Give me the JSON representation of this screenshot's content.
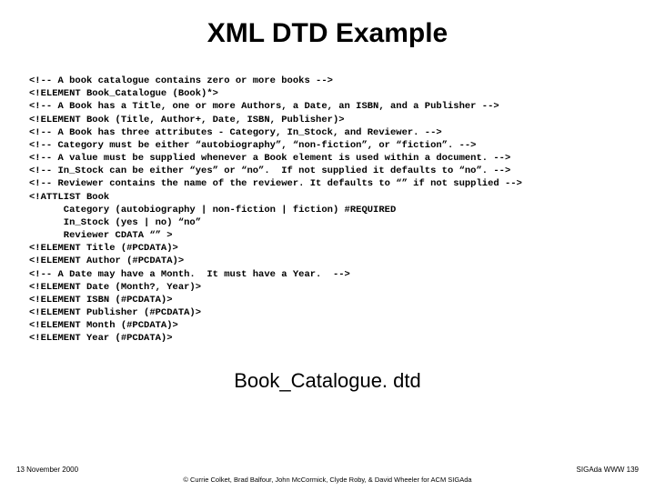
{
  "title": "XML DTD Example",
  "code": "<!-- A book catalogue contains zero or more books -->\n<!ELEMENT Book_Catalogue (Book)*>\n<!-- A Book has a Title, one or more Authors, a Date, an ISBN, and a Publisher -->\n<!ELEMENT Book (Title, Author+, Date, ISBN, Publisher)>\n<!-- A Book has three attributes - Category, In_Stock, and Reviewer. -->\n<!-- Category must be either “autobiography”, “non-fiction”, or “fiction”. -->\n<!-- A value must be supplied whenever a Book element is used within a document. -->\n<!-- In_Stock can be either “yes” or “no”.  If not supplied it defaults to “no”. -->\n<!-- Reviewer contains the name of the reviewer. It defaults to “” if not supplied -->\n<!ATTLIST Book\n      Category (autobiography | non-fiction | fiction) #REQUIRED\n      In_Stock (yes | no) “no”\n      Reviewer CDATA “” >\n<!ELEMENT Title (#PCDATA)>\n<!ELEMENT Author (#PCDATA)>\n<!-- A Date may have a Month.  It must have a Year.  -->\n<!ELEMENT Date (Month?, Year)>\n<!ELEMENT ISBN (#PCDATA)>\n<!ELEMENT Publisher (#PCDATA)>\n<!ELEMENT Month (#PCDATA)>\n<!ELEMENT Year (#PCDATA)>",
  "subtitle": "Book_Catalogue. dtd",
  "footer": {
    "date": "13 November 2000",
    "right": "SIGAda WWW 139",
    "credit": "© Currie Colket, Brad Balfour, John McCormick, Clyde Roby, & David Wheeler for ACM SIGAda"
  }
}
